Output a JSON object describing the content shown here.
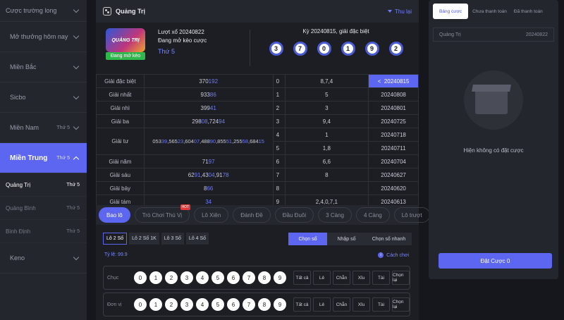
{
  "sidebar": {
    "items": [
      {
        "label": "Cược trường long"
      },
      {
        "label": "Mở thưởng hôm nay"
      },
      {
        "label": "Miền Bắc"
      },
      {
        "label": "Sicbo"
      },
      {
        "label": "Miền Nam",
        "day": "Thứ 5"
      },
      {
        "label": "Miền Trung",
        "day": "Thứ 5"
      }
    ],
    "sub": [
      {
        "label": "Quảng Trị",
        "day": "Thứ 5"
      },
      {
        "label": "Quảng Bình",
        "day": "Thứ 5"
      },
      {
        "label": "Bình Định",
        "day": "Thứ 5"
      }
    ],
    "keno": "Keno"
  },
  "header": {
    "title": "Quảng Trị",
    "back": "Thu lại"
  },
  "draw": {
    "logo_text": "QUẢNG TRỊ",
    "status_badge": "Đang mở kèo",
    "round": "Lượt xổ 20240822",
    "status": "Đang mở kèo cược",
    "weekday": "Thứ 5",
    "result_title": "Kỳ 20240815, giải đặc biệt",
    "balls": [
      "3",
      "7",
      "0",
      "1",
      "9",
      "2"
    ]
  },
  "results": [
    {
      "name": "Giải đặc biệt",
      "pre": "370",
      "hl": "192",
      "post": "",
      "head": "0",
      "tail": "8,7,4",
      "date": "20240815"
    },
    {
      "name": "Giải nhất",
      "pre": "933",
      "hl": "86",
      "post": "",
      "head": "1",
      "tail": "5",
      "date": "20240808"
    },
    {
      "name": "Giải nhì",
      "pre": "399",
      "hl": "41",
      "post": "",
      "head": "2",
      "tail": "3",
      "date": "20240801"
    },
    {
      "name": "Giải ba",
      "pre": "298",
      "hl": "08",
      "post": ",724",
      "hl2": "94",
      "head": "3",
      "tail": "9,4",
      "date": "20240725"
    },
    {
      "name": "Giải tư",
      "pre": "053",
      "hl": "39",
      "post": ",565",
      "hl2": "23",
      "rest": ",604",
      "hl3": "07",
      "rest2": ",488",
      "hl4": "90",
      "rest3": ",855",
      "hl5": "51",
      "rest4": ",255",
      "hl6": "58",
      "rest5": ",684",
      "hl7": "15",
      "head": "4",
      "tail": "1",
      "date": "20240718"
    },
    {
      "name": "",
      "head": "5",
      "tail": "1,8",
      "date": "20240711"
    },
    {
      "name": "Giải năm",
      "pre": "71",
      "hl": "97",
      "post": "",
      "head": "6",
      "tail": "6,6",
      "date": "20240704"
    },
    {
      "name": "Giải sáu",
      "pre": "62",
      "hl": "91",
      "post": ",43",
      "hl2": "04",
      "rest": ",91",
      "hl3": "78",
      "head": "7",
      "tail": "8",
      "date": "20240627"
    },
    {
      "name": "Giải bảy",
      "pre": "8",
      "hl": "66",
      "post": "",
      "head": "8",
      "tail": "",
      "date": "20240620"
    },
    {
      "name": "Giải tám",
      "pre": "",
      "hl": "34",
      "post": "",
      "head": "9",
      "tail": "2,4,0,7,1",
      "date": "20240613"
    }
  ],
  "bet_tabs": [
    "Bao lô",
    "Trò Chơi Thú Vị",
    "Lô Xiên",
    "Đánh Đề",
    "Đầu Đuôi",
    "3 Càng",
    "4 Càng",
    "Lô trượt"
  ],
  "hot_label": "HOT",
  "sub_tabs": [
    "Lô 2 Số",
    "Lô 2 Số 1K",
    "Lô 3 Số",
    "Lô 4 Số"
  ],
  "modes": [
    "Chọn số",
    "Nhập số",
    "Chọn số nhanh"
  ],
  "ratio": "Tỷ lệ:  99.9",
  "how_to": "Cách chơi",
  "pick_rows": [
    {
      "label": "Chục"
    },
    {
      "label": "Đơn vị"
    }
  ],
  "digits": [
    "0",
    "1",
    "2",
    "3",
    "4",
    "5",
    "6",
    "7",
    "8",
    "9"
  ],
  "quick": [
    "Tất cả",
    "Lẻ",
    "Chẵn",
    "Xỉu",
    "Tài",
    "Chọn lại"
  ],
  "right": {
    "tabs": [
      "Bảng cược",
      "Chưa thanh toán",
      "Đã thanh toán"
    ],
    "lottery": "Quảng Trị",
    "round": "20240822",
    "empty": "Hiện không có đặt cược",
    "place": "Đặt Cược 0"
  },
  "colors": {
    "accent": "#5c66f0",
    "highlight": "#6c79ff",
    "badge_green": "#2eb84b"
  }
}
